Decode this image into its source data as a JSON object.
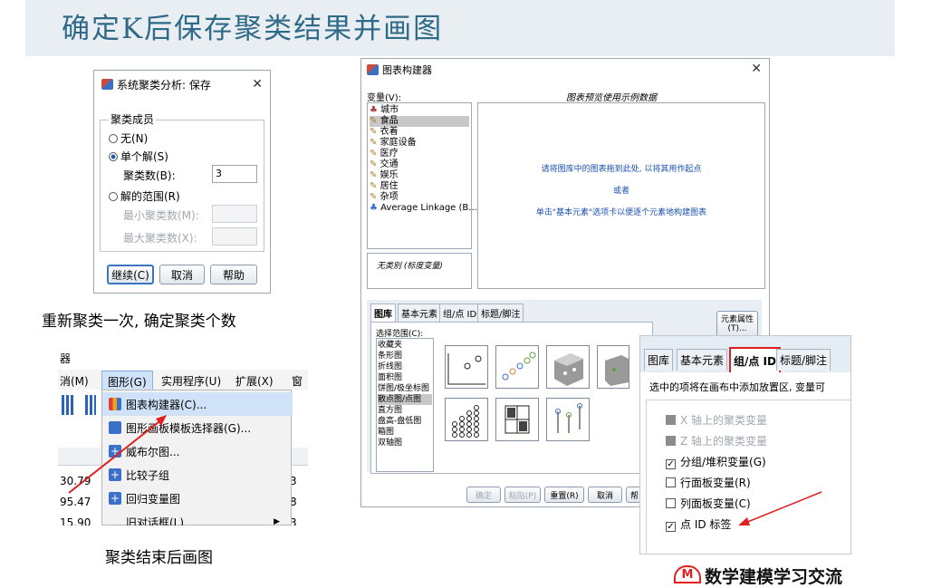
{
  "banner": {
    "title": "确定K后保存聚类结果并画图"
  },
  "save_dialog": {
    "title": "系统聚类分析: 保存",
    "group": "聚类成员",
    "opt_none": "无(N)",
    "opt_single": "单个解(S)",
    "clusters_label": "聚类数(B):",
    "clusters_value": "3",
    "opt_range": "解的范围(R)",
    "min_label": "最小聚类数(M):",
    "max_label": "最大聚类数(X):",
    "btn_continue": "继续(C)",
    "btn_cancel": "取消",
    "btn_help": "帮助"
  },
  "caption_left": "重新聚类一次, 确定聚类个数",
  "caption_bottom": "聚类结束后画图",
  "menu": {
    "top_label": "器",
    "bar": [
      "消(M)",
      "图形(G)",
      "实用程序(U)",
      "扩展(X)",
      "窗"
    ],
    "items": [
      "图表构建器(C)...",
      "图形画板模板选择器(G)...",
      "威布尔图...",
      "比较子组",
      "回归变量图",
      "旧对话框(L)"
    ],
    "cells": [
      "30.79",
      "95.47",
      "15.90"
    ],
    "right_cells": [
      "3",
      "8",
      "3"
    ]
  },
  "builder": {
    "title": "图表构建器",
    "vars_label": "变量(V):",
    "preview_label": "图表预览使用示例数据",
    "variables": [
      "城市",
      "食品",
      "衣着",
      "家庭设备",
      "医疗",
      "交通",
      "娱乐",
      "居住",
      "杂项",
      "Average Linkage (B..."
    ],
    "no_cat": "无类别 (标度变量)",
    "hint1": "请将图库中的图表拖到此处, 以将其用作起点",
    "hint2": "或者",
    "hint3": "单击\"基本元素\"选项卡以便逐个元素地构建图表",
    "tabs": [
      "图库",
      "基本元素",
      "组/点 ID",
      "标题/脚注"
    ],
    "choose_label": "选择范围(C):",
    "gallery": [
      "收藏夹",
      "条形图",
      "折线图",
      "面积图",
      "饼图/极坐标图",
      "散点图/点图",
      "直方图",
      "盘高-盘低图",
      "箱图",
      "双轴图"
    ],
    "elem_btn": "元素属性(T)...",
    "btns": [
      "确定",
      "粘贴(P)",
      "重置(R)",
      "取消",
      "帮"
    ]
  },
  "groupid": {
    "tabs": [
      "图库",
      "基本元素",
      "组/点 ID",
      "标题/脚注"
    ],
    "desc": "选中的项将在画布中添加放置区, 变量可",
    "opts": [
      "X 轴上的聚类变量",
      "Z 轴上的聚类变量",
      "分组/堆积变量(G)",
      "行面板变量(R)",
      "列面板变量(C)",
      "点 ID 标签"
    ]
  },
  "logo": {
    "text": "数学建模学习交流"
  }
}
